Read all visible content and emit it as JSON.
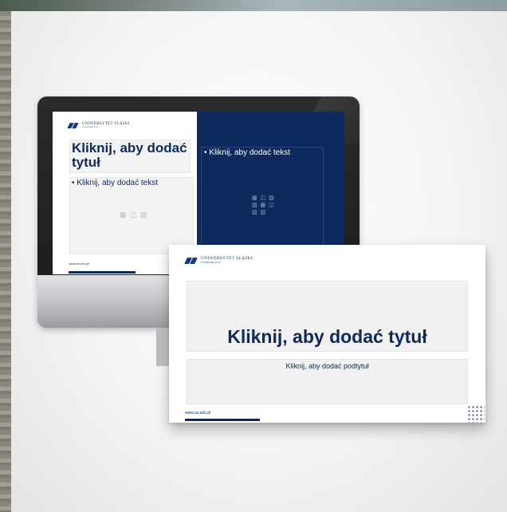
{
  "monitor_slide": {
    "logo_text": "UNIWERSYTET ŚLĄSKI",
    "logo_sub": "W KATOWICACH",
    "title": "Kliknij, aby dodać tytuł",
    "body_left": "• Kliknij, aby dodać tekst",
    "body_right": "• Kliknij, aby dodać tekst",
    "placeholder_icons": "▦ ◫ ▧",
    "right_icons": "▦ ◫ ▧ ▨ ▦ ◫ ▧ ▨",
    "url": "www.us.edu.pl"
  },
  "front_slide": {
    "logo_text": "UNIWERSYTET ŚLĄSKI",
    "logo_sub": "W KATOWICACH",
    "title": "Kliknij, aby dodać tytuł",
    "subtitle": "Kliknij, aby dodać podtytuł",
    "url": "www.us.edu.pl"
  },
  "colors": {
    "brand_navy": "#0e2a5c",
    "logo_blue": "#1a3a78",
    "monitor_bezel": "#1f1f21",
    "background": "#f4f4f4"
  }
}
